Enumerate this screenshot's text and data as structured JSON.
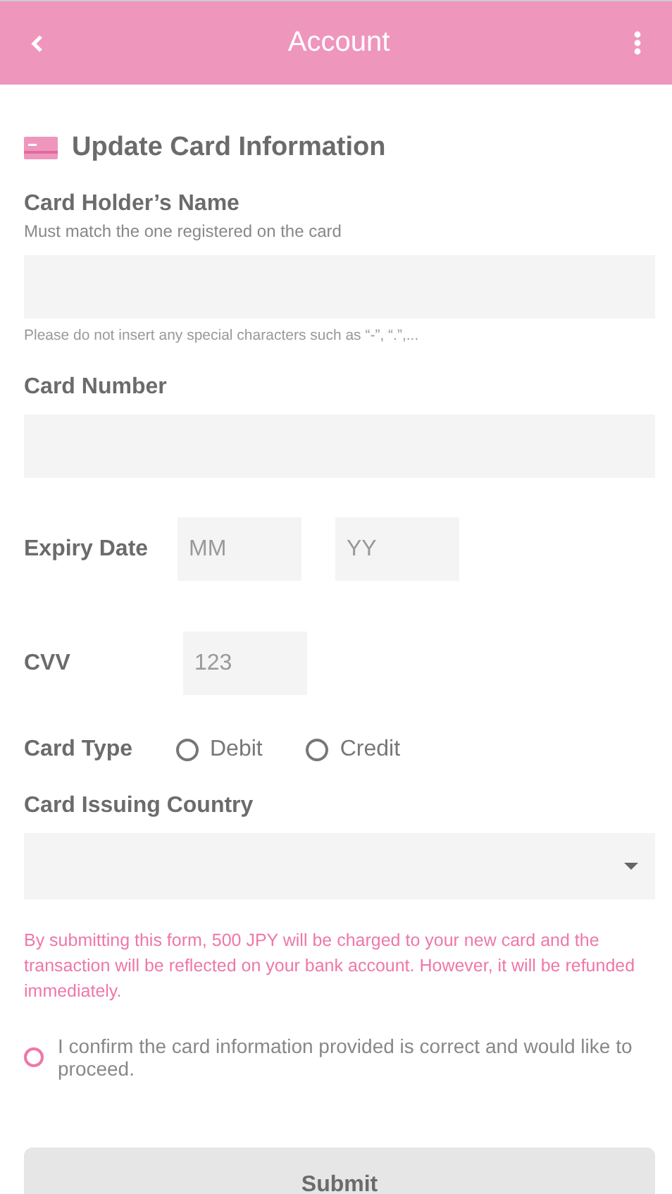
{
  "header": {
    "title": "Account"
  },
  "form": {
    "title": "Update Card Information",
    "holder": {
      "label": "Card Holder’s Name",
      "hint": "Must match the one registered on the card",
      "note": "Please do not insert any special characters such as “-”, “.”,..."
    },
    "number": {
      "label": "Card Number"
    },
    "expiry": {
      "label": "Expiry Date",
      "month_placeholder": "MM",
      "year_placeholder": "YY"
    },
    "cvv": {
      "label": "CVV",
      "placeholder": "123"
    },
    "card_type": {
      "label": "Card Type",
      "options": [
        {
          "label": "Debit",
          "selected": false
        },
        {
          "label": "Credit",
          "selected": false
        }
      ]
    },
    "country": {
      "label": "Card Issuing Country"
    },
    "notice": "By submitting this form, 500 JPY will be charged to your new card and the transaction will be reflected on your bank account. However, it will be refunded immediately.",
    "confirm": {
      "label": "I confirm the card information provided is correct and would like to proceed.",
      "checked": false
    },
    "submit": "Submit"
  }
}
